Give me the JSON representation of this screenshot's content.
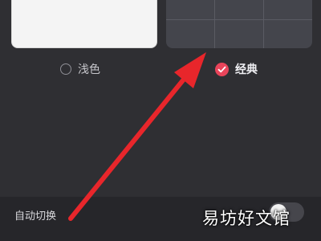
{
  "themes": [
    {
      "label": "浅色",
      "selected": false
    },
    {
      "label": "经典",
      "selected": true
    }
  ],
  "settings": {
    "auto_switch_label": "自动切换",
    "auto_switch_enabled": false
  },
  "watermark": {
    "text": "易坊好文馆"
  },
  "colors": {
    "background": "#2f2f33",
    "accent": "#e9445a",
    "annotation_arrow": "#e8262b"
  },
  "icons": {
    "selected_radio": "check-circle-icon",
    "unselected_radio": "radio-empty-icon"
  }
}
